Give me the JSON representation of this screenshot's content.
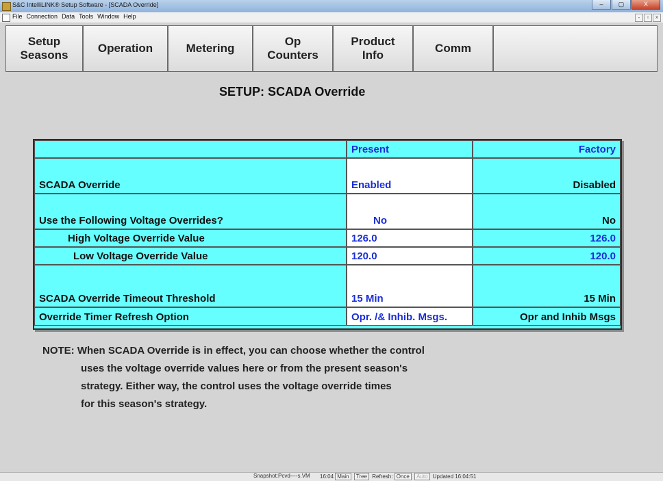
{
  "window": {
    "title": "S&C IntelliLINK® Setup Software - [SCADA Override]",
    "buttons": [
      "–",
      "▢",
      "X"
    ]
  },
  "menu": {
    "items": [
      "File",
      "Connection",
      "Data",
      "Tools",
      "Window",
      "Help"
    ],
    "mdi_buttons": [
      "-",
      "▫",
      "×"
    ]
  },
  "tabs": [
    {
      "line1": "Setup",
      "line2": "Seasons"
    },
    {
      "line1": "Operation",
      "line2": ""
    },
    {
      "line1": "Metering",
      "line2": ""
    },
    {
      "line1": "Op",
      "line2": "Counters"
    },
    {
      "line1": "Product",
      "line2": "Info"
    },
    {
      "line1": "Comm",
      "line2": ""
    },
    {
      "line1": "",
      "line2": ""
    }
  ],
  "page": {
    "heading": "SETUP: SCADA Override"
  },
  "table": {
    "headers": {
      "label": "",
      "present": "Present",
      "factory": "Factory"
    },
    "rows": [
      {
        "label": "SCADA Override",
        "present": "Enabled",
        "factory": "Disabled"
      },
      {
        "label": "Use the Following Voltage Overrides?",
        "present": "No",
        "factory": "No"
      },
      {
        "label": "High Voltage Override Value",
        "present": "126.0",
        "factory": "126.0"
      },
      {
        "label": "Low Voltage Override Value",
        "present": "120.0",
        "factory": "120.0"
      },
      {
        "label": "SCADA Override Timeout Threshold",
        "present": "15 Min",
        "factory": "15 Min"
      },
      {
        "label": "Override Timer Refresh Option",
        "present": "Opr. /& Inhib. Msgs.",
        "factory": "Opr and Inhib Msgs"
      }
    ]
  },
  "note": {
    "line1": "NOTE: When SCADA Override is in effect, you can choose whether the control",
    "line2": "uses the voltage override values here or from the present season's",
    "line3": "strategy. Either way, the control uses the voltage override times",
    "line4": "for this season's strategy."
  },
  "status": {
    "snapshot": "Snapshot:Pcvd----s.VM",
    "time": "16:04",
    "main": "Main",
    "tree": "Tree",
    "refresh_label": "Refresh:",
    "once": "Once",
    "auto": "Auto",
    "updated": "Updated 16:04:51"
  }
}
